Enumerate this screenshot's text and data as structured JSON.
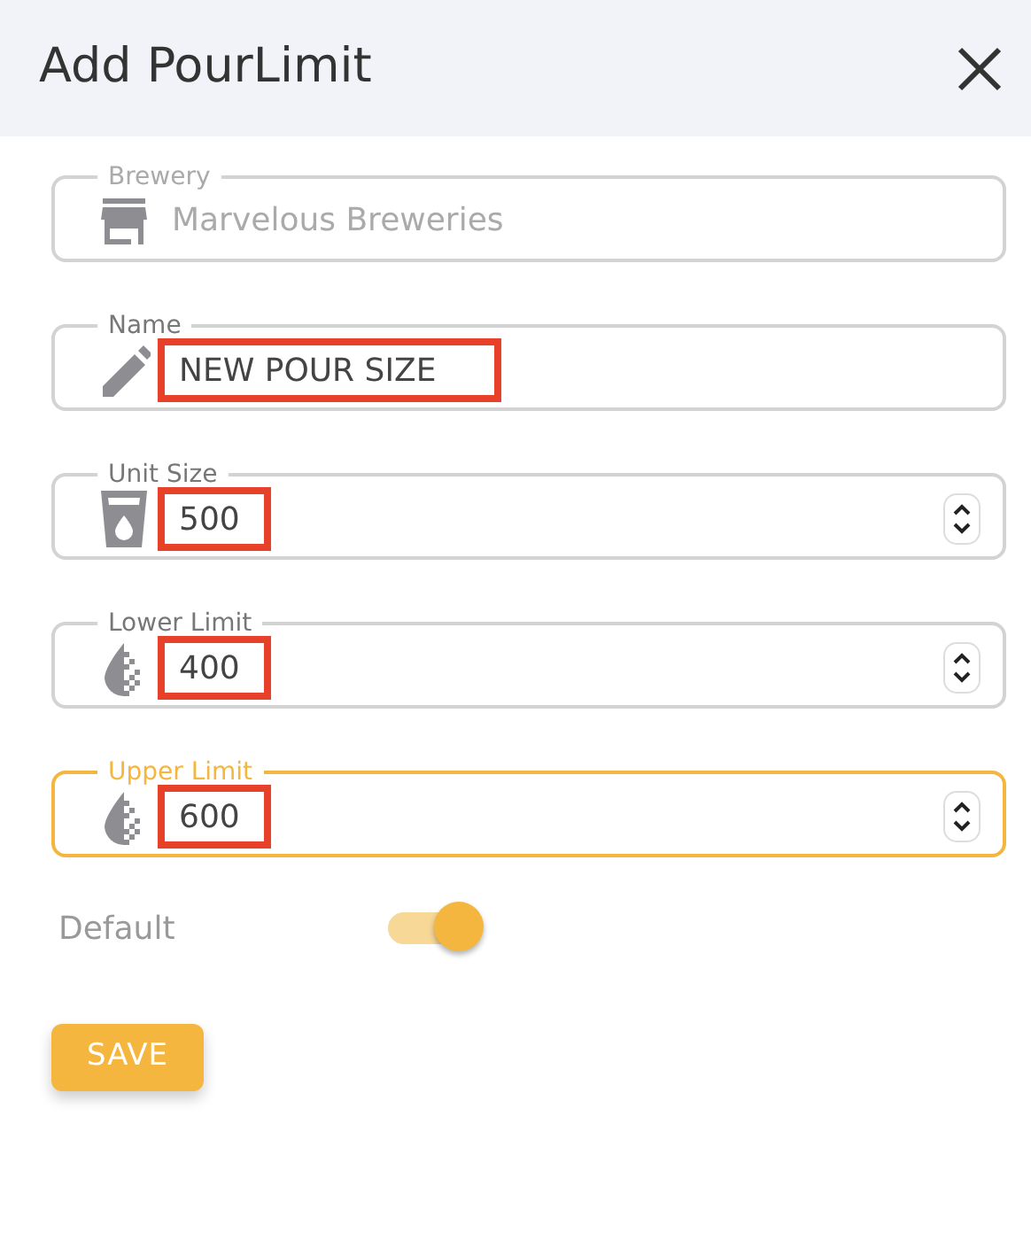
{
  "dialog": {
    "title": "Add PourLimit"
  },
  "fields": [
    {
      "label": "Brewery",
      "kind": "brewery",
      "value": "Marvelous Breweries",
      "disabled": true,
      "focused": false,
      "highlighted": false
    },
    {
      "label": "Name",
      "kind": "name",
      "value": "NEW POUR SIZE",
      "disabled": false,
      "focused": false,
      "highlighted": true
    },
    {
      "label": "Unit Size",
      "kind": "unit",
      "value": "500",
      "disabled": false,
      "focused": false,
      "highlighted": true
    },
    {
      "label": "Lower Limit",
      "kind": "limit",
      "value": "400",
      "disabled": false,
      "focused": false,
      "highlighted": true
    },
    {
      "label": "Upper Limit",
      "kind": "limit",
      "value": "600",
      "disabled": false,
      "focused": true,
      "highlighted": true
    }
  ],
  "default_toggle": {
    "label": "Default",
    "on": true
  },
  "save_button": {
    "label": "SAVE"
  }
}
